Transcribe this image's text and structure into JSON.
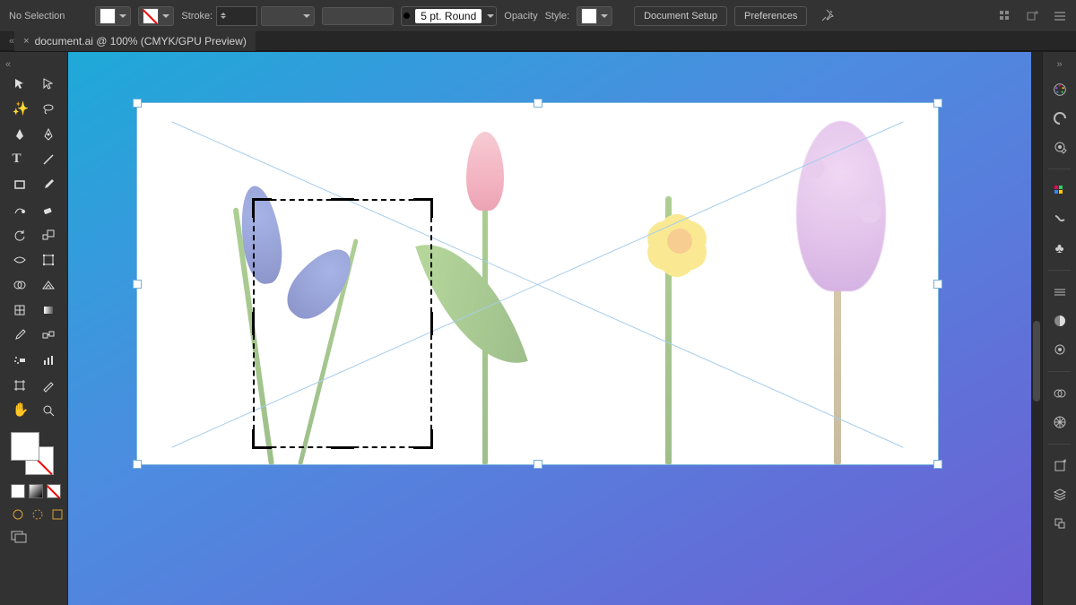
{
  "topbar": {
    "no_selection": "No Selection",
    "stroke_label": "Stroke:",
    "stroke_value": "",
    "brush_value": "5 pt. Round",
    "opacity_label": "Opacity",
    "style_label": "Style:",
    "doc_setup": "Document Setup",
    "preferences": "Preferences"
  },
  "tab": {
    "title": "document.ai @ 100% (CMYK/GPU Preview)"
  },
  "tools": [
    [
      "selection-tool",
      "direct-selection-tool"
    ],
    [
      "magic-wand-tool",
      "lasso-tool"
    ],
    [
      "pen-tool",
      "curvature-tool"
    ],
    [
      "type-tool",
      "line-segment-tool"
    ],
    [
      "rectangle-tool",
      "paintbrush-tool"
    ],
    [
      "shaper-tool",
      "eraser-tool"
    ],
    [
      "rotate-tool",
      "scale-tool"
    ],
    [
      "width-tool",
      "free-transform-tool"
    ],
    [
      "shape-builder-tool",
      "perspective-grid-tool"
    ],
    [
      "mesh-tool",
      "gradient-tool"
    ],
    [
      "eyedropper-tool",
      "blend-tool"
    ],
    [
      "symbol-sprayer-tool",
      "column-graph-tool"
    ],
    [
      "artboard-tool",
      "slice-tool"
    ],
    [
      "hand-tool",
      "zoom-tool"
    ]
  ],
  "panels": [
    "color-panel",
    "color-guide-panel",
    "properties-panel",
    "swatches-panel",
    "brushes-panel",
    "symbols-panel",
    "stroke-panel",
    "transparency-panel",
    "appearance-panel",
    "cc-libraries-panel",
    "asset-export-panel",
    "layers-panel",
    "artboards-panel",
    "links-panel"
  ],
  "canvas": {
    "image_items": [
      "muscari",
      "tulip",
      "daffodil",
      "hyacinth"
    ]
  }
}
